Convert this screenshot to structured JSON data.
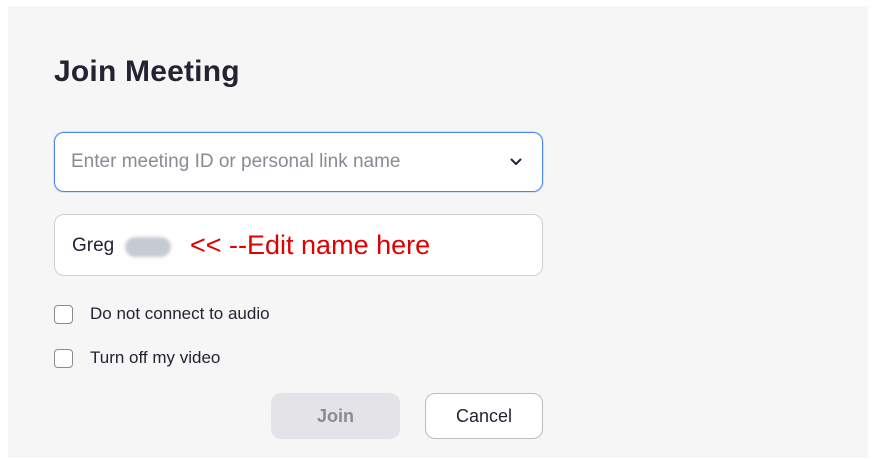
{
  "dialog": {
    "title": "Join Meeting"
  },
  "meeting_id": {
    "placeholder": "Enter meeting ID or personal link name",
    "value": "",
    "dropdown_icon": "chevron-down-icon"
  },
  "name_field": {
    "value": "Greg",
    "annotation": "<< --Edit name here",
    "annotation_color": "#e00000"
  },
  "options": [
    {
      "label": "Do not connect to audio",
      "checked": false
    },
    {
      "label": "Turn off my video",
      "checked": false
    }
  ],
  "buttons": {
    "join_label": "Join",
    "cancel_label": "Cancel"
  },
  "colors": {
    "focus_border": "#4a86f0",
    "text_primary": "#232333",
    "disabled_button_bg": "#e4e4e8"
  }
}
